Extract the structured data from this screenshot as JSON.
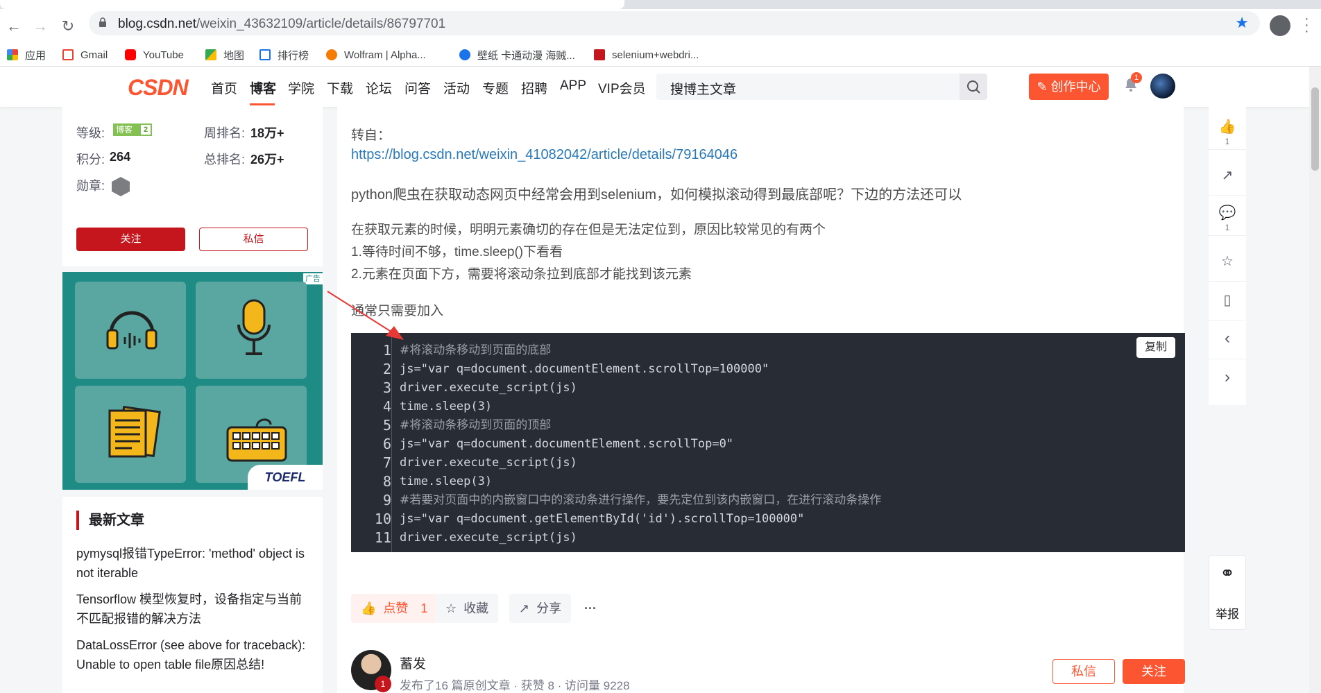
{
  "browser": {
    "url_host": "blog.csdn.net",
    "url_path": "/weixin_43632109/article/details/86797701",
    "bookmarks": [
      "应用",
      "Gmail",
      "YouTube",
      "地图",
      "排行榜",
      "Wolfram | Alpha...",
      "壁纸 卡通动漫 海贼...",
      "selenium+webdri..."
    ],
    "bookmark_colors": [
      "#ea4335",
      "#ea4335",
      "#ff0000",
      "#34a853",
      "#1a73e8",
      "#f57c00",
      "#1a73e8",
      "#c4161c"
    ]
  },
  "header": {
    "logo": "CSDN",
    "nav": [
      "首页",
      "博客",
      "学院",
      "下载",
      "论坛",
      "问答",
      "活动",
      "专题",
      "招聘",
      "APP",
      "VIP会员"
    ],
    "active_nav": "博客",
    "search_placeholder": "搜博主文章",
    "create_label": "创作中心",
    "notification_count": "1"
  },
  "profile": {
    "level_label": "等级:",
    "level_badge": "博客",
    "level_num": "2",
    "weekly_rank_label": "周排名:",
    "weekly_rank": "18万+",
    "points_label": "积分:",
    "points": "264",
    "total_rank_label": "总排名:",
    "total_rank": "26万+",
    "medal_label": "勋章:",
    "follow": "关注",
    "message": "私信"
  },
  "ad": {
    "tag": "广告",
    "brand": "TOEFL"
  },
  "recent": {
    "title": "最新文章",
    "items": [
      "pymysql报错TypeError: 'method' object is not iterable",
      "Tensorflow 模型恢复时，设备指定与当前不匹配报错的解决方法",
      "DataLossError (see above for traceback): Unable to open table file原因总结!"
    ]
  },
  "article": {
    "from_label": "转自：",
    "source_link": "https://blog.csdn.net/weixin_41082042/article/details/79164046",
    "para1": "python爬虫在获取动态网页中经常会用到selenium，如何模拟滚动得到最底部呢？下边的方法还可以",
    "para2_l1": "在获取元素的时候，明明元素确切的存在但是无法定位到，原因比较常见的有两个",
    "para2_l2": "1.等待时间不够，time.sleep()下看看",
    "para2_l3": "2.元素在页面下方，需要将滚动条拉到底部才能找到该元素",
    "para3": "通常只需要加入",
    "copy_label": "复制",
    "code": [
      {
        "n": "1",
        "text": "#将滚动条移动到页面的底部",
        "comment": true
      },
      {
        "n": "2",
        "text": "js=\"var q=document.documentElement.scrollTop=100000\"",
        "comment": false
      },
      {
        "n": "3",
        "text": "driver.execute_script(js)",
        "comment": false
      },
      {
        "n": "4",
        "text": "time.sleep(3)",
        "comment": false
      },
      {
        "n": "5",
        "text": "#将滚动条移动到页面的顶部",
        "comment": true
      },
      {
        "n": "6",
        "text": "js=\"var q=document.documentElement.scrollTop=0\"",
        "comment": false
      },
      {
        "n": "7",
        "text": "driver.execute_script(js)",
        "comment": false
      },
      {
        "n": "8",
        "text": "time.sleep(3)",
        "comment": false
      },
      {
        "n": "9",
        "text": "#若要对页面中的内嵌窗口中的滚动条进行操作，要先定位到该内嵌窗口，在进行滚动条操作",
        "comment": true
      },
      {
        "n": "10",
        "text": "js=\"var q=document.getElementById('id').scrollTop=100000\"",
        "comment": false
      },
      {
        "n": "11",
        "text": "driver.execute_script(js)",
        "comment": false
      }
    ]
  },
  "actions": {
    "like": "点赞",
    "like_count": "1",
    "collect": "收藏",
    "share": "分享",
    "more": "···"
  },
  "author": {
    "name": "蓄发",
    "badge": "1",
    "meta": "发布了16 篇原创文章 · 获赞 8 · 访问量 9228",
    "message": "私信",
    "follow": "关注"
  },
  "right_toolbar": {
    "like_count": "1",
    "comment_count": "1",
    "report": "举报"
  }
}
